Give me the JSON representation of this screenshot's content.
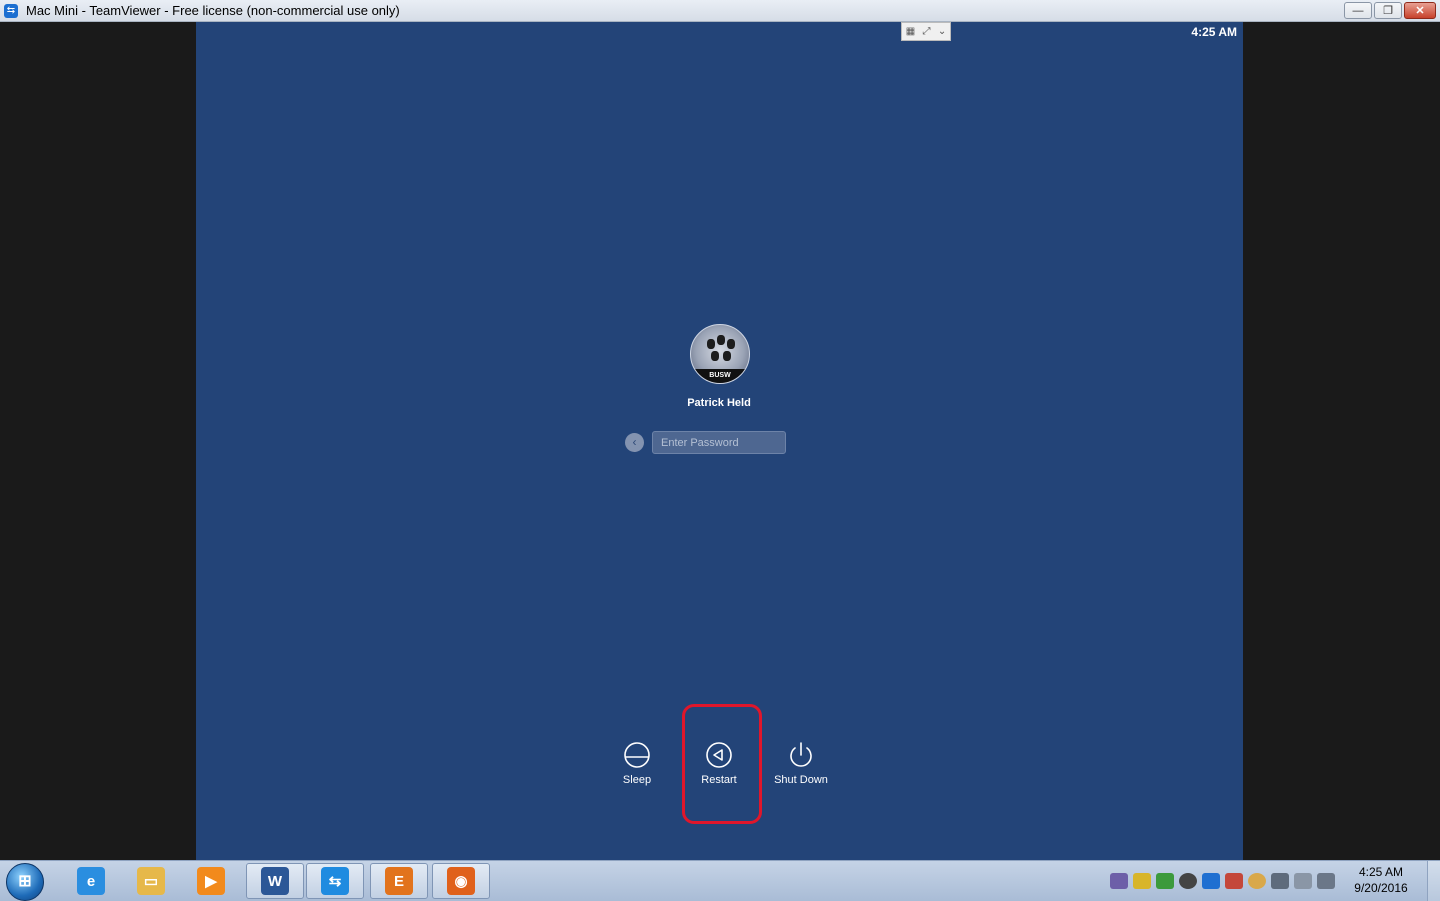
{
  "window": {
    "title": "Mac Mini - TeamViewer - Free license (non-commercial use only)",
    "minimize": "—",
    "restore": "❐",
    "close": "✕"
  },
  "remote": {
    "clock": "4:25 AM",
    "login": {
      "username": "Patrick Held",
      "avatar_text": "BUSW",
      "password_placeholder": "Enter Password",
      "back_glyph": "‹"
    },
    "power": {
      "sleep_label": "Sleep",
      "restart_label": "Restart",
      "shutdown_label": "Shut Down"
    }
  },
  "taskbar": {
    "start_glyph": "⊞",
    "apps": [
      {
        "name": "Internet Explorer",
        "glyph": "e",
        "color": "#2a8ee0"
      },
      {
        "name": "Windows Explorer",
        "glyph": "▭",
        "color": "#e6b84a"
      },
      {
        "name": "Media Player",
        "glyph": "▶",
        "color": "#f28a1c"
      },
      {
        "name": "Microsoft Word",
        "glyph": "W",
        "color": "#2b5797"
      },
      {
        "name": "TeamViewer",
        "glyph": "⇆",
        "color": "#1f8be0"
      },
      {
        "name": "E App",
        "glyph": "E",
        "color": "#e2731c"
      },
      {
        "name": "Firefox",
        "glyph": "◉",
        "color": "#e0611b"
      }
    ],
    "clock_time": "4:25 AM",
    "clock_date": "9/20/2016"
  },
  "colors": {
    "remote_bg": "#234478",
    "highlight": "#e0162b"
  }
}
